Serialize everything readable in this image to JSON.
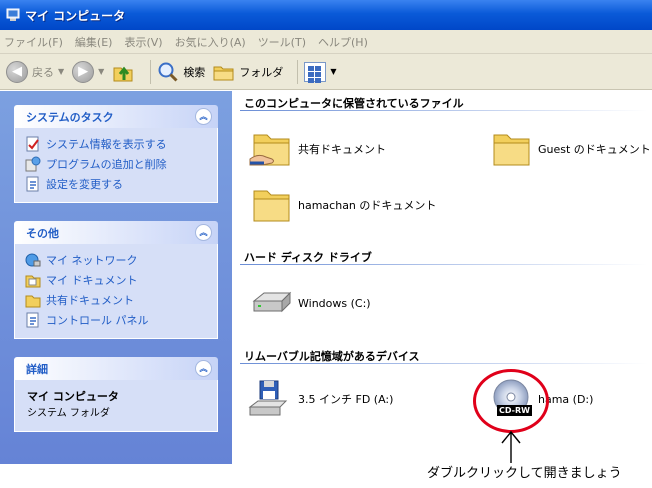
{
  "window": {
    "title": "マイ コンピュータ"
  },
  "menu": [
    "ファイル(F)",
    "編集(E)",
    "表示(V)",
    "お気に入り(A)",
    "ツール(T)",
    "ヘルプ(H)"
  ],
  "toolbar": {
    "back_label": "戻る",
    "search_label": "検索",
    "folders_label": "フォルダ"
  },
  "left_pane": {
    "system_tasks": {
      "title": "システムのタスク",
      "items": [
        "システム情報を表示する",
        "プログラムの追加と削除",
        "設定を変更する"
      ]
    },
    "other_places": {
      "title": "その他",
      "items": [
        "マイ ネットワーク",
        "マイ ドキュメント",
        "共有ドキュメント",
        "コントロール パネル"
      ]
    },
    "details": {
      "title": "詳細",
      "name": "マイ コンピュータ",
      "subtitle": "システム フォルダ"
    }
  },
  "main": {
    "files_group": {
      "title": "このコンピュータに保管されているファイル",
      "items": [
        "共有ドキュメント",
        "Guest のドキュメント",
        "hamachan のドキュメント"
      ]
    },
    "hdd_group": {
      "title": "ハード ディスク ドライブ",
      "items": [
        "Windows (C:)"
      ]
    },
    "removable_group": {
      "title": "リムーバブル記憶域があるデバイス",
      "items": [
        "3.5 インチ FD (A:)",
        "hama (D:)"
      ],
      "cd_badge": "CD-RW"
    }
  },
  "annotation": {
    "text": "ダブルクリックして開きましょう"
  },
  "colors": {
    "titlebar": "#0a5ad8",
    "task_link": "#215dc6",
    "annotation_ring": "#e0001a"
  }
}
